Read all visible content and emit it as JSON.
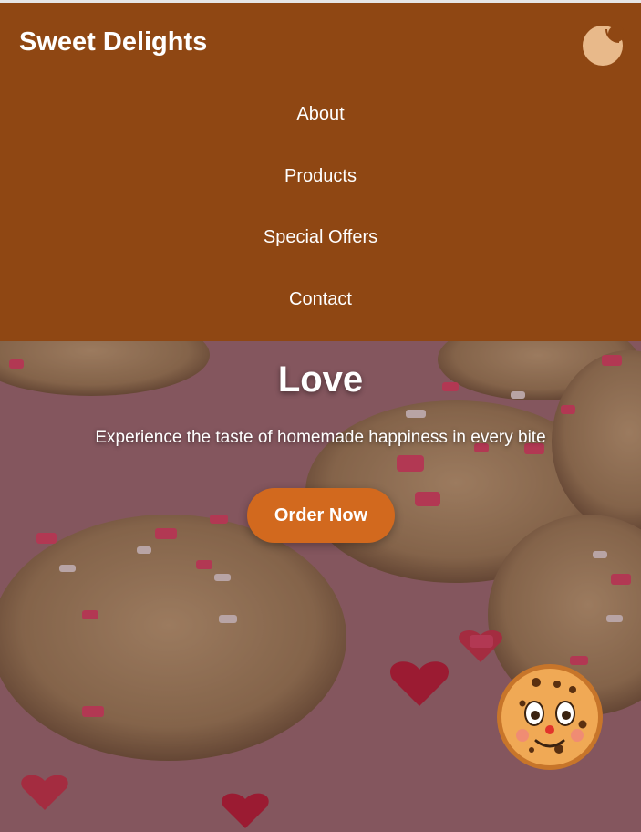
{
  "brand": {
    "title": "Sweet Delights",
    "logo_icon": "cookie-icon"
  },
  "nav": {
    "items": [
      {
        "label": "About"
      },
      {
        "label": "Products"
      },
      {
        "label": "Special Offers"
      },
      {
        "label": "Contact"
      }
    ]
  },
  "hero": {
    "title": "Love",
    "subtitle": "Experience the taste of homemade happiness in every bite",
    "cta_label": "Order Now",
    "background_image": "cookies-with-heart-sprinkles"
  },
  "mascot": {
    "icon": "cookie-face-icon"
  },
  "colors": {
    "header_bg": "#8f4713",
    "accent": "#d2691e",
    "logo": "#e8b98a",
    "text": "#ffffff"
  }
}
